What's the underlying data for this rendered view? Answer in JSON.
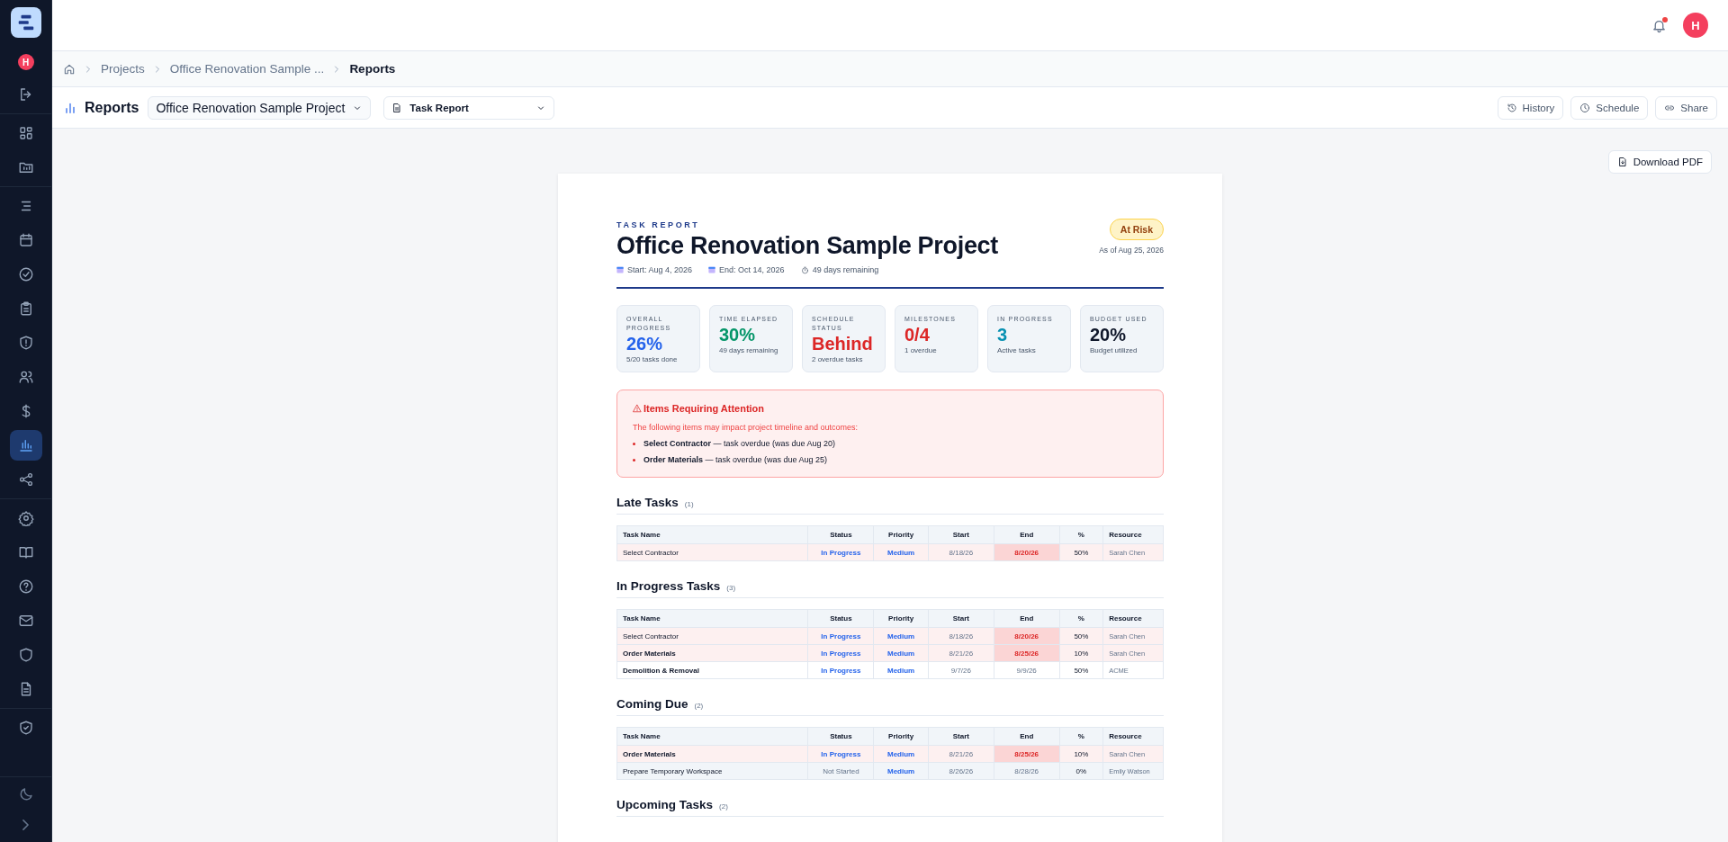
{
  "topbar": {
    "notifications_unread": true,
    "avatar_initial": "H"
  },
  "sidebar": {
    "avatar_initial": "H",
    "groups": [
      [
        {
          "selected": false
        }
      ],
      [
        {
          "selected": false
        },
        {
          "selected": false
        }
      ],
      [
        {
          "selected": false
        },
        {
          "selected": false
        },
        {
          "selected": false
        },
        {
          "selected": false
        },
        {
          "selected": false
        },
        {
          "selected": false
        },
        {
          "selected": false
        },
        {
          "selected": true
        },
        {
          "selected": false
        }
      ],
      [
        {
          "selected": false
        },
        {
          "selected": false
        },
        {
          "selected": false
        },
        {
          "selected": false
        },
        {
          "selected": false
        },
        {
          "selected": false
        }
      ],
      [
        {
          "selected": false
        }
      ]
    ],
    "bottom": [
      {
        "selected": false
      },
      {
        "selected": false
      }
    ]
  },
  "breadcrumb": [
    "Projects",
    "Office Renovation Sample ...",
    "Reports"
  ],
  "toolbar": {
    "title": "Reports",
    "project_select": "Office Renovation Sample Project",
    "report_select": "Task Report",
    "buttons": [
      "History",
      "Schedule",
      "Share"
    ]
  },
  "download_button": "Download PDF",
  "report": {
    "eyebrow": "TASK REPORT",
    "title": "Office Renovation Sample Project",
    "status_badge": "At Risk",
    "as_of": "As of Aug 25, 2026",
    "meta": [
      "Start: Aug 4, 2026",
      "End: Oct 14, 2026",
      "49 days remaining"
    ],
    "metrics": [
      {
        "label": "OVERALL PROGRESS",
        "value": "26%",
        "sub": "5/20 tasks done",
        "color": "#2563eb"
      },
      {
        "label": "TIME ELAPSED",
        "value": "30%",
        "sub": "49 days remaining",
        "color": "#059669"
      },
      {
        "label": "SCHEDULE STATUS",
        "value": "Behind",
        "sub": "2 overdue tasks",
        "color": "#dc2626"
      },
      {
        "label": "MILESTONES",
        "value": "0/4",
        "sub": "1 overdue",
        "color": "#dc2626"
      },
      {
        "label": "IN PROGRESS",
        "value": "3",
        "sub": "Active tasks",
        "color": "#0891b2"
      },
      {
        "label": "BUDGET USED",
        "value": "20%",
        "sub": "Budget utilized",
        "color": "#0f172a"
      }
    ],
    "attention": {
      "title": "Items Requiring Attention",
      "intro": "The following items may impact project timeline and outcomes:",
      "items": [
        "**Select Contractor** — task overdue (was due Aug 20)",
        "**Order Materials** — task overdue (was due Aug 25)"
      ]
    },
    "sections": [
      {
        "title": "Late Tasks",
        "count": "(1)",
        "columns": [
          "Task Name",
          "Status",
          "Priority",
          "Start",
          "End",
          "%",
          "Resource"
        ],
        "rows": [
          {
            "kind": "late",
            "bold": false,
            "cells": [
              "Select Contractor",
              "In Progress",
              "Medium",
              "8/18/26",
              "8/20/26",
              "50%",
              "Sarah Chen"
            ],
            "started": true
          }
        ]
      },
      {
        "title": "In Progress Tasks",
        "count": "(3)",
        "columns": [
          "Task Name",
          "Status",
          "Priority",
          "Start",
          "End",
          "%",
          "Resource"
        ],
        "rows": [
          {
            "kind": "late",
            "bold": false,
            "cells": [
              "Select Contractor",
              "In Progress",
              "Medium",
              "8/18/26",
              "8/20/26",
              "50%",
              "Sarah Chen"
            ],
            "started": true
          },
          {
            "kind": "late",
            "bold": true,
            "cells": [
              "Order Materials",
              "In Progress",
              "Medium",
              "8/21/26",
              "8/25/26",
              "10%",
              "Sarah Chen"
            ],
            "started": true
          },
          {
            "kind": "normal",
            "bold": true,
            "cells": [
              "Demolition & Removal",
              "In Progress",
              "Medium",
              "9/7/26",
              "9/9/26",
              "50%",
              "ACME"
            ],
            "started": true
          }
        ]
      },
      {
        "title": "Coming Due",
        "count": "(2)",
        "columns": [
          "Task Name",
          "Status",
          "Priority",
          "Start",
          "End",
          "%",
          "Resource"
        ],
        "rows": [
          {
            "kind": "late",
            "bold": true,
            "cells": [
              "Order Materials",
              "In Progress",
              "Medium",
              "8/21/26",
              "8/25/26",
              "10%",
              "Sarah Chen"
            ],
            "started": true
          },
          {
            "kind": "due",
            "bold": false,
            "cells": [
              "Prepare Temporary Workspace",
              "Not Started",
              "Medium",
              "8/26/26",
              "8/28/26",
              "0%",
              "Emily Watson"
            ],
            "started": false
          }
        ]
      },
      {
        "title": "Upcoming Tasks",
        "count": "(2)"
      }
    ]
  }
}
